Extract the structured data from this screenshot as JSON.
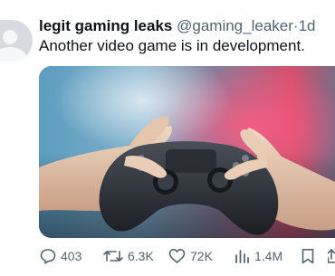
{
  "tweet": {
    "display_name": "legit gaming leaks",
    "handle": "@gaming_leaker",
    "separator": "·",
    "time": "1d",
    "text": "Another video game is in development.",
    "media": {
      "icon": "photo-game-controller-hands",
      "colors": {
        "bg_blue": "#6fa9c7",
        "bg_pink": "#e0486e",
        "controller": "#2b2f36",
        "skin": "#e6cbb3"
      }
    },
    "actions": {
      "reply": {
        "icon": "reply-icon",
        "count": "403"
      },
      "retweet": {
        "icon": "retweet-icon",
        "count": "6.3K"
      },
      "like": {
        "icon": "heart-icon",
        "count": "72K"
      },
      "views": {
        "icon": "views-icon",
        "count": "1.4M"
      },
      "bookmark": {
        "icon": "bookmark-icon"
      },
      "share": {
        "icon": "share-icon"
      }
    }
  }
}
